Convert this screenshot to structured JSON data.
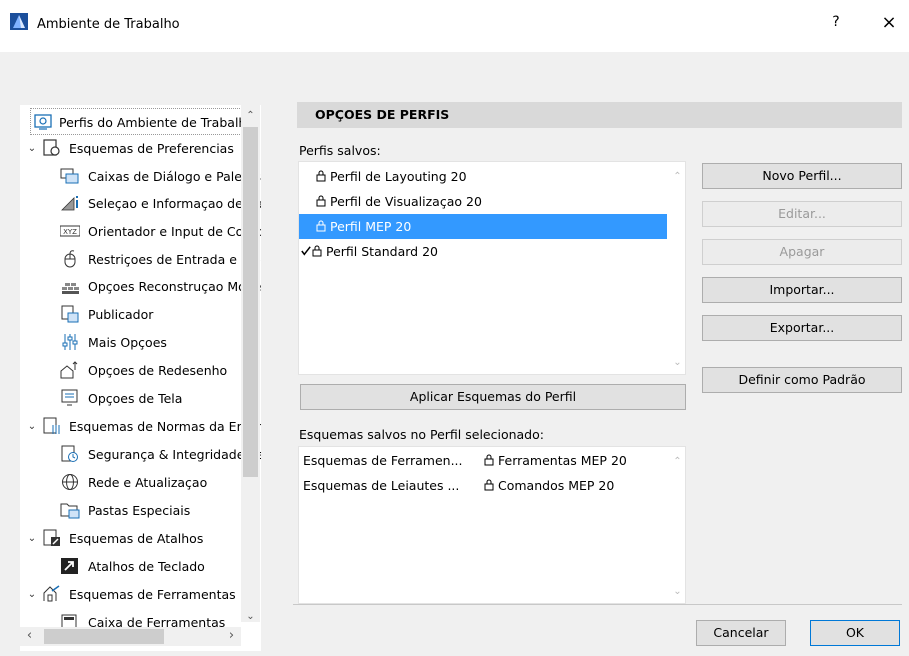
{
  "window": {
    "title": "Ambiente de Trabalho",
    "help": "?",
    "close": "×"
  },
  "tree": {
    "items": [
      {
        "label": "Perfis do Ambiente de Trabalho",
        "icon": "workspace-profile-icon"
      },
      {
        "label": "Esquemas de Preferencias",
        "icon": "preferences-scheme-icon"
      },
      {
        "label": "Caixas de Diálogo e Paletas",
        "icon": "dialog-boxes-icon"
      },
      {
        "label": "Seleçao e Informaçao de Elemento",
        "icon": "selection-info-icon"
      },
      {
        "label": "Orientador e Input de Coordenadas",
        "icon": "xyz-icon"
      },
      {
        "label": "Restriçoes de Entrada e Edição",
        "icon": "mouse-icon"
      },
      {
        "label": "Opçoes Reconstruçao Modelo",
        "icon": "rebuild-icon"
      },
      {
        "label": "Publicador",
        "icon": "publisher-icon"
      },
      {
        "label": "Mais Opçoes",
        "icon": "more-options-icon"
      },
      {
        "label": "Opçoes de Redesenho",
        "icon": "redraw-icon"
      },
      {
        "label": "Opçoes de Tela",
        "icon": "screen-options-icon"
      },
      {
        "label": "Esquemas de Normas da Empresa",
        "icon": "company-standards-icon"
      },
      {
        "label": "Segurança & Integridade de Dados",
        "icon": "security-icon"
      },
      {
        "label": "Rede e Atualizaçao",
        "icon": "globe-icon"
      },
      {
        "label": "Pastas Especiais",
        "icon": "folders-icon"
      },
      {
        "label": "Esquemas de Atalhos",
        "icon": "shortcut-scheme-icon"
      },
      {
        "label": "Atalhos de Teclado",
        "icon": "keyboard-shortcut-icon"
      },
      {
        "label": "Esquemas de Ferramentas",
        "icon": "tool-scheme-icon"
      },
      {
        "label": "Caixa de Ferramentas",
        "icon": "toolbox-icon"
      }
    ]
  },
  "main": {
    "header": "OPÇOES DE PERFIS",
    "saved_profiles_label": "Perfis salvos:",
    "profiles": [
      {
        "name": "Perfil de Layouting 20",
        "checked": false,
        "selected": false
      },
      {
        "name": "Perfil de Visualizaçao 20",
        "checked": false,
        "selected": false
      },
      {
        "name": "Perfil MEP 20",
        "checked": false,
        "selected": true
      },
      {
        "name": "Perfil Standard 20",
        "checked": true,
        "selected": false
      }
    ],
    "apply_button": "Aplicar Esquemas do Perfil",
    "schemes_label": "Esquemas salvos no Perfil selecionado:",
    "schemes": [
      {
        "type": "Esquemas de Ferramen...",
        "value": "Ferramentas MEP 20"
      },
      {
        "type": "Esquemas de Leiautes ...",
        "value": "Comandos MEP 20"
      }
    ],
    "buttons": {
      "new": "Novo Perfil...",
      "edit": "Editar...",
      "delete": "Apagar",
      "import": "Importar...",
      "export": "Exportar...",
      "set_default": "Definir como Padrão"
    }
  },
  "footer": {
    "cancel": "Cancelar",
    "ok": "OK"
  },
  "colors": {
    "selection": "#3399ff",
    "header_bg": "#d9d9d9",
    "accent": "#0078d7"
  }
}
